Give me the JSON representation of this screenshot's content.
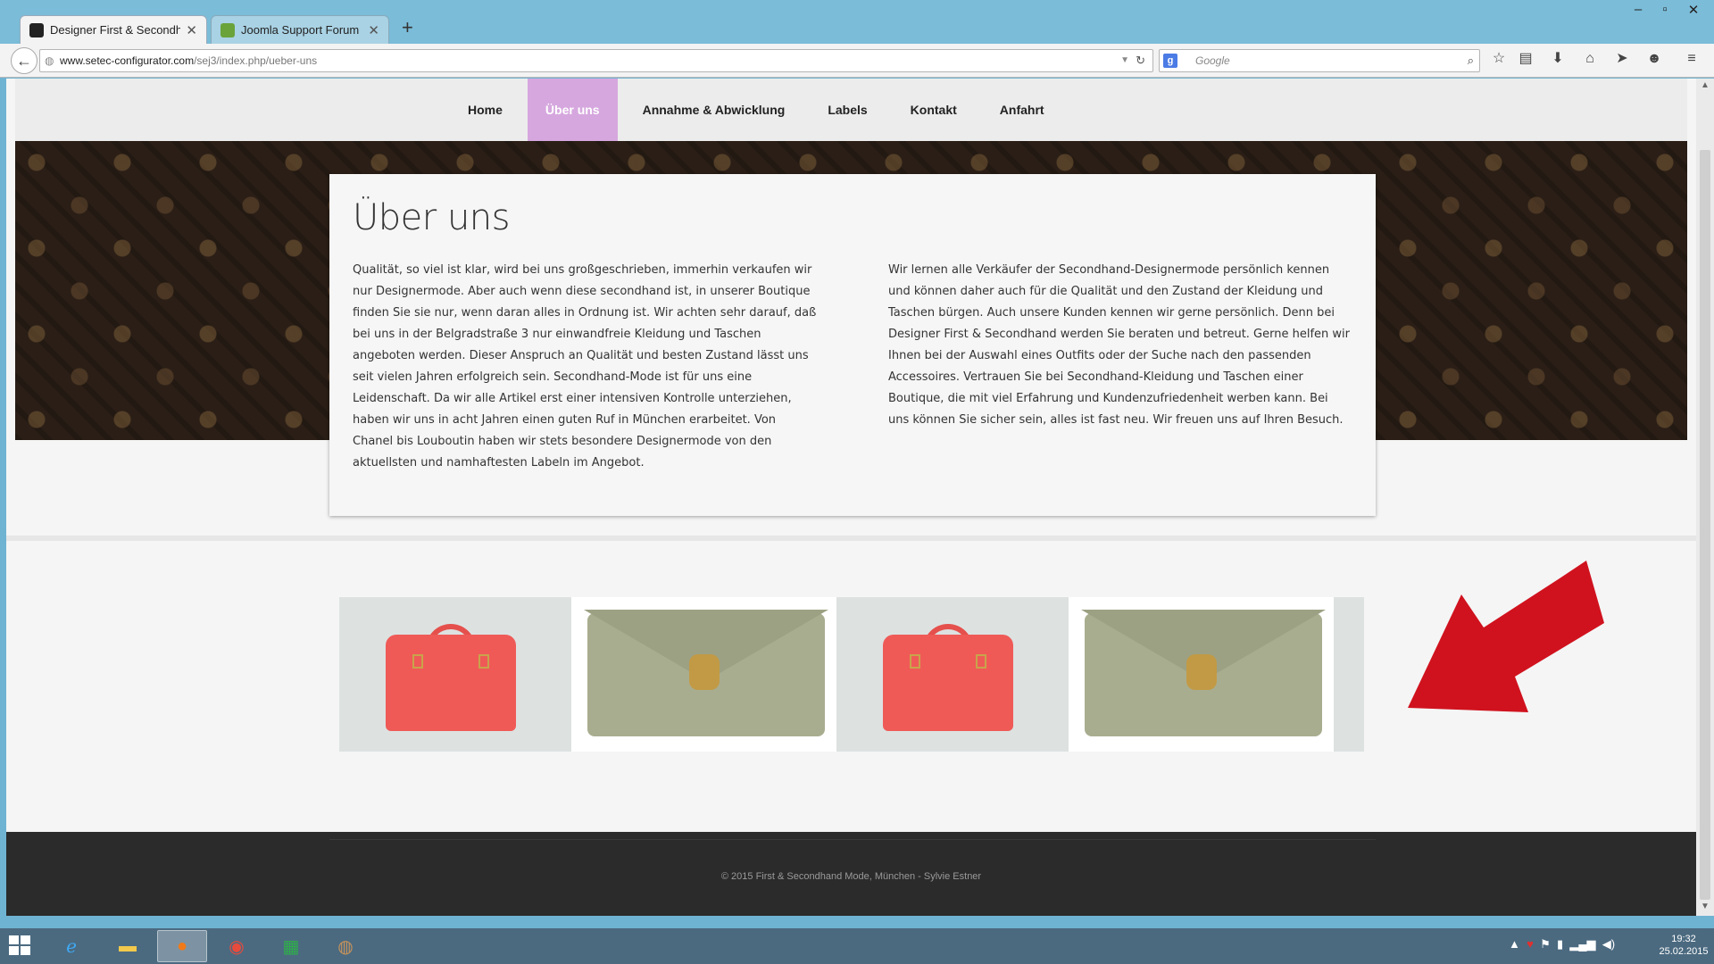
{
  "browser": {
    "tabs": [
      {
        "title": "Designer First & Secondha...",
        "favicon_color": "#222222"
      },
      {
        "title": "Joomla Support Forum :: N...",
        "favicon_color": "#6aa33a"
      }
    ],
    "new_tab": "+",
    "url_domain": "www.setec-configurator.com",
    "url_path": "/sej3/index.php/ueber-uns",
    "search_placeholder": "Google"
  },
  "site": {
    "menu": [
      {
        "label": "Home"
      },
      {
        "label": "Über uns"
      },
      {
        "label": "Annahme & Abwicklung"
      },
      {
        "label": "Labels"
      },
      {
        "label": "Kontakt"
      },
      {
        "label": "Anfahrt"
      }
    ],
    "page_title": "Über uns",
    "col_left": "Qualität, so viel ist klar, wird bei uns großgeschrieben, immerhin verkaufen wir nur Designermode. Aber auch wenn diese secondhand ist, in unserer Boutique finden Sie sie nur, wenn daran alles in Ordnung ist. Wir achten sehr darauf, daß bei uns in der Belgradstraße 3 nur einwandfreie Kleidung und Taschen angeboten werden. Dieser Anspruch an Qualität und besten Zustand lässt uns seit vielen Jahren erfolgreich sein. Secondhand-Mode ist für uns eine Leidenschaft. Da wir alle Artikel erst einer intensiven Kontrolle unterziehen, haben wir uns in acht Jahren einen guten Ruf in München erarbeitet. Von Chanel bis Louboutin haben wir stets besondere Designermode von den aktuellsten und namhaftesten Labeln im Angebot.",
    "col_right": "Wir lernen alle Verkäufer der Secondhand-Designermode persönlich kennen und können daher auch für die Qualität und den Zustand der Kleidung und Taschen bürgen. Auch unsere Kunden kennen wir gerne persönlich. Denn bei Designer First & Secondhand werden Sie beraten und betreut. Gerne helfen wir Ihnen bei der Auswahl eines Outfits oder der Suche nach den passenden Accessoires. Vertrauen Sie bei Secondhand-Kleidung und Taschen einer Boutique, die mit viel Erfahrung und Kundenzufriedenheit werben kann. Bei uns können Sie sicher sein, alles ist fast neu. Wir freuen uns auf Ihren Besuch.",
    "footer_text": "© 2015 First & Secondhand Mode, München - Sylvie Estner",
    "accent_color": "#d6a7de",
    "arrow_color": "#d0121e"
  },
  "taskbar": {
    "time": "19:32",
    "date": "25.02.2015"
  }
}
